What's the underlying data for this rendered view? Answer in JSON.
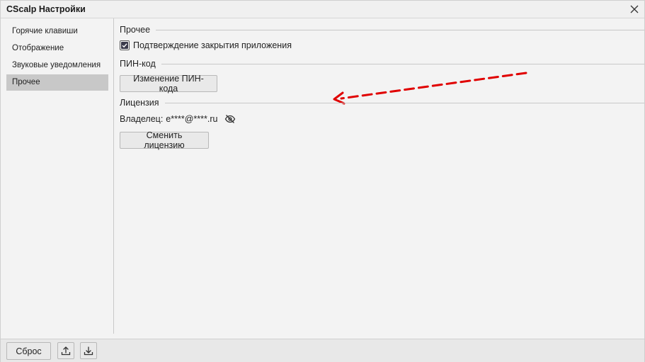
{
  "window": {
    "title": "CScalp Настройки",
    "close_icon": "close-icon"
  },
  "sidebar": {
    "items": [
      {
        "label": "Горячие клавиши",
        "active": false
      },
      {
        "label": "Отображение",
        "active": false
      },
      {
        "label": "Звуковые уведомления",
        "active": false
      },
      {
        "label": "Прочее",
        "active": true
      }
    ]
  },
  "main": {
    "section_misc": {
      "title": "Прочее",
      "confirm_close": {
        "label": "Подтверждение закрытия приложения",
        "checked": true
      }
    },
    "section_pin": {
      "title": "ПИН-код",
      "change_pin_label": "Изменение ПИН-кода"
    },
    "section_license": {
      "title": "Лицензия",
      "owner_label": "Владелец:",
      "owner_value": "e****@****.ru",
      "visibility_icon": "eye-hidden-icon",
      "change_license_label": "Сменить лицензию"
    },
    "annotation": {
      "arrow_color": "#e00000",
      "arrow_style": "dashed"
    }
  },
  "footer": {
    "reset_label": "Сброс",
    "upload_icon": "upload-icon",
    "download_icon": "download-icon"
  },
  "colors": {
    "background": "#f3f3f3",
    "active_item": "#c8c8c8",
    "checkbox_fill": "#3a3a4a"
  }
}
